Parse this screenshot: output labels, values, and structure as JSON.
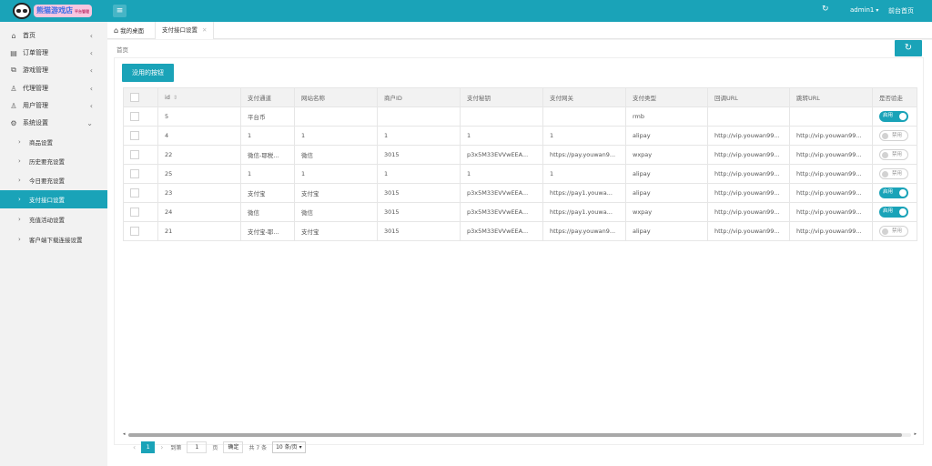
{
  "header": {
    "logo_text": "熊猫游戏店",
    "logo_sub": "平台管理",
    "menu_icon": "≡",
    "refresh_icon": "↻",
    "user": "admin1",
    "user_caret": "▾",
    "home_link": "前台首页"
  },
  "sidebar": {
    "items": [
      {
        "icon": "⌂",
        "label": "首页",
        "arrow": "‹"
      },
      {
        "icon": "▤",
        "label": "订单管理",
        "arrow": "‹"
      },
      {
        "icon": "⧉",
        "label": "游戏管理",
        "arrow": "‹"
      },
      {
        "icon": "♙",
        "label": "代理管理",
        "arrow": "‹"
      },
      {
        "icon": "♙",
        "label": "用户管理",
        "arrow": "‹"
      },
      {
        "icon": "⚙",
        "label": "系统设置",
        "arrow": "⌄"
      }
    ],
    "subitems": [
      {
        "label": "商品设置",
        "chev": "›"
      },
      {
        "label": "历史要充设置",
        "chev": "›"
      },
      {
        "label": "今日要充设置",
        "chev": "›"
      },
      {
        "label": "支付接口设置",
        "chev": "›",
        "active": true
      },
      {
        "label": "充值活动设置",
        "chev": "›"
      },
      {
        "label": "客户端下载连接设置",
        "chev": "›"
      }
    ]
  },
  "tabs": {
    "home": "我的桌面",
    "home_icon": "⌂",
    "active": "支付接口设置",
    "close": "✕"
  },
  "breadcrumb": "首页",
  "refresh_btn": "↻",
  "useless_btn": "没用的按钮",
  "table": {
    "sort_icon": "⇕",
    "columns": [
      "",
      "id",
      "支付通道",
      "网站名称",
      "商户ID",
      "支付秘钥",
      "支付网关",
      "支付类型",
      "回调URL",
      "跳转URL",
      "是否验走"
    ],
    "rows": [
      {
        "id": "5",
        "channel": "平台币",
        "site": "",
        "merchant": "",
        "secret": "",
        "gateway": "",
        "type": "rmb",
        "callback": "",
        "redirect": "",
        "enabled": true
      },
      {
        "id": "4",
        "channel": "1",
        "site": "1",
        "merchant": "1",
        "secret": "1",
        "gateway": "1",
        "type": "alipay",
        "callback": "http://vip.youwan99...",
        "redirect": "http://vip.youwan99...",
        "enabled": false
      },
      {
        "id": "22",
        "channel": "微信-耶税...",
        "site": "微信",
        "merchant": "3015",
        "secret": "p3x5M33EVVwEEA...",
        "gateway": "https://pay.youwan9...",
        "type": "wxpay",
        "callback": "http://vip.youwan99...",
        "redirect": "http://vip.youwan99...",
        "enabled": false
      },
      {
        "id": "25",
        "channel": "1",
        "site": "1",
        "merchant": "1",
        "secret": "1",
        "gateway": "1",
        "type": "alipay",
        "callback": "http://vip.youwan99...",
        "redirect": "http://vip.youwan99...",
        "enabled": false
      },
      {
        "id": "23",
        "channel": "支付宝",
        "site": "支付宝",
        "merchant": "3015",
        "secret": "p3x5M33EVVwEEA...",
        "gateway": "https://pay1.youwa...",
        "type": "alipay",
        "callback": "http://vip.youwan99...",
        "redirect": "http://vip.youwan99...",
        "enabled": true
      },
      {
        "id": "24",
        "channel": "微信",
        "site": "微信",
        "merchant": "3015",
        "secret": "p3x5M33EVVwEEA...",
        "gateway": "https://pay1.youwa...",
        "type": "wxpay",
        "callback": "http://vip.youwan99...",
        "redirect": "http://vip.youwan99...",
        "enabled": true
      },
      {
        "id": "21",
        "channel": "支付宝-耶...",
        "site": "支付宝",
        "merchant": "3015",
        "secret": "p3x5M33EVVwEEA...",
        "gateway": "https://pay.youwan9...",
        "type": "alipay",
        "callback": "http://vip.youwan99...",
        "redirect": "http://vip.youwan99...",
        "enabled": false
      }
    ],
    "switch_on": "启用",
    "switch_off": "禁用"
  },
  "pager": {
    "prev": "‹",
    "next": "›",
    "current": "1",
    "goto_label": "到第",
    "goto_value": "1",
    "page_unit": "页",
    "confirm": "确定",
    "total": "共 7 条",
    "page_size": "10 条/页 ▾"
  },
  "colors": {
    "accent": "#1aa3b8"
  }
}
